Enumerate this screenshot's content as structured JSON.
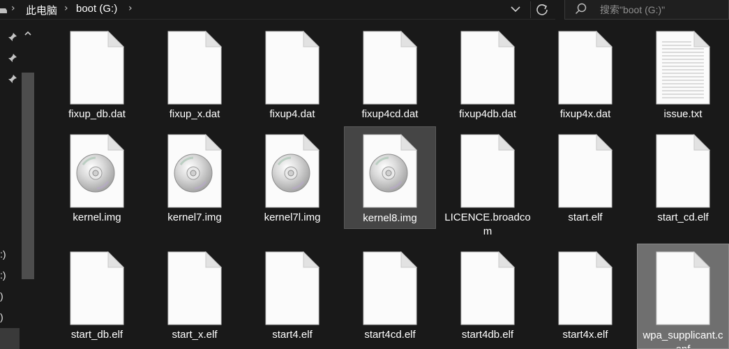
{
  "address_bar": {
    "crumbs": [
      "此电脑",
      "boot (G:)"
    ]
  },
  "search": {
    "placeholder": "搜索\"boot (G:)\""
  },
  "nav": {
    "drive_labels": [
      ":)",
      ":)",
      ")",
      ")"
    ]
  },
  "files": [
    {
      "name": "fixup_db.dat",
      "icon": "blank-file-icon"
    },
    {
      "name": "fixup_x.dat",
      "icon": "blank-file-icon"
    },
    {
      "name": "fixup4.dat",
      "icon": "blank-file-icon"
    },
    {
      "name": "fixup4cd.dat",
      "icon": "blank-file-icon"
    },
    {
      "name": "fixup4db.dat",
      "icon": "blank-file-icon"
    },
    {
      "name": "fixup4x.dat",
      "icon": "blank-file-icon"
    },
    {
      "name": "issue.txt",
      "icon": "text-file-icon"
    },
    {
      "name": "kernel.img",
      "icon": "disc-image-icon"
    },
    {
      "name": "kernel7.img",
      "icon": "disc-image-icon"
    },
    {
      "name": "kernel7l.img",
      "icon": "disc-image-icon"
    },
    {
      "name": "kernel8.img",
      "icon": "disc-image-icon",
      "state": "hover"
    },
    {
      "name": "LICENCE.broadcom",
      "icon": "blank-file-icon"
    },
    {
      "name": "start.elf",
      "icon": "blank-file-icon"
    },
    {
      "name": "start_cd.elf",
      "icon": "blank-file-icon"
    },
    {
      "name": "start_db.elf",
      "icon": "blank-file-icon"
    },
    {
      "name": "start_x.elf",
      "icon": "blank-file-icon"
    },
    {
      "name": "start4.elf",
      "icon": "blank-file-icon"
    },
    {
      "name": "start4cd.elf",
      "icon": "blank-file-icon"
    },
    {
      "name": "start4db.elf",
      "icon": "blank-file-icon"
    },
    {
      "name": "start4x.elf",
      "icon": "blank-file-icon"
    },
    {
      "name": "wpa_supplicant.conf",
      "icon": "blank-file-icon",
      "state": "selected"
    }
  ],
  "colors": {
    "background": "#191919",
    "hover": "#454545",
    "selected": "#6f6f6f",
    "page": "#ffffff"
  }
}
